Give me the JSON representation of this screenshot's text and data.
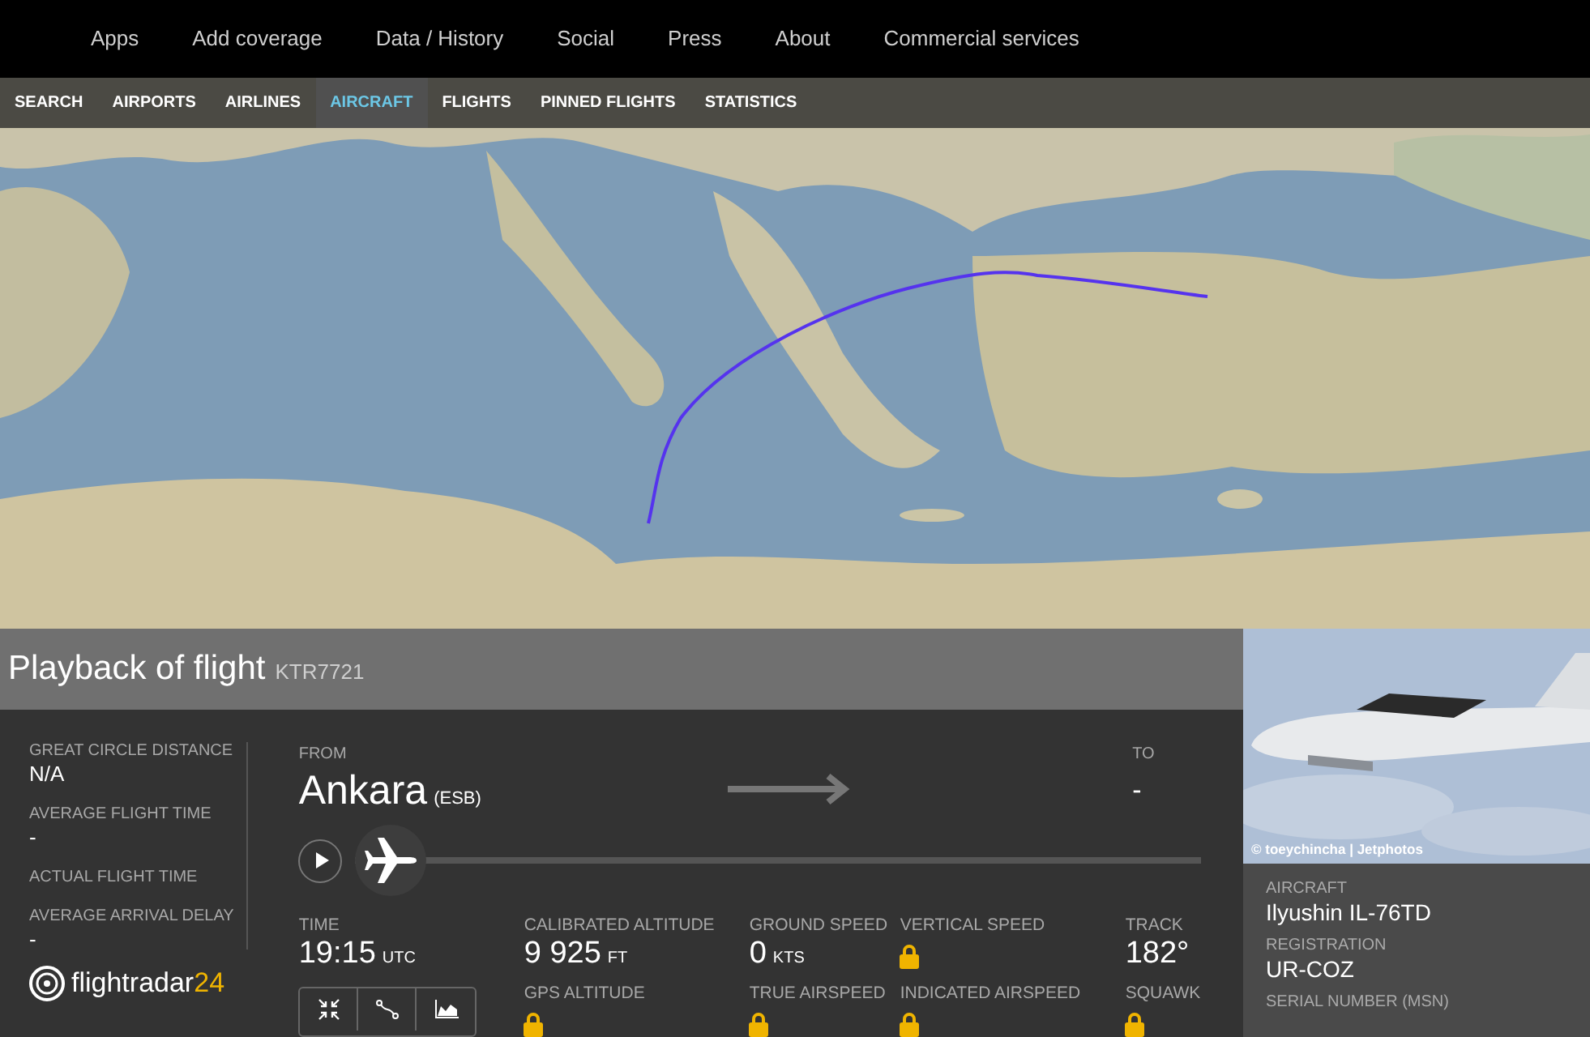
{
  "top_nav": [
    "Apps",
    "Add coverage",
    "Data / History",
    "Social",
    "Press",
    "About",
    "Commercial services"
  ],
  "sub_nav": [
    {
      "label": "SEARCH",
      "selected": false
    },
    {
      "label": "AIRPORTS",
      "selected": false
    },
    {
      "label": "AIRLINES",
      "selected": false
    },
    {
      "label": "AIRCRAFT",
      "selected": true
    },
    {
      "label": "FLIGHTS",
      "selected": false
    },
    {
      "label": "PINNED FLIGHTS",
      "selected": false
    },
    {
      "label": "STATISTICS",
      "selected": false
    }
  ],
  "header": {
    "title": "Playback of flight",
    "flight": "KTR7721"
  },
  "summary": [
    {
      "label": "GREAT CIRCLE DISTANCE",
      "value": "N/A"
    },
    {
      "label": "AVERAGE FLIGHT TIME",
      "value": "-"
    },
    {
      "label": "ACTUAL FLIGHT TIME"
    },
    {
      "label": "AVERAGE ARRIVAL DELAY",
      "value": "-"
    }
  ],
  "logo": {
    "name": "flightradar",
    "suffix": "24"
  },
  "route": {
    "from_label": "FROM",
    "from_city": "Ankara",
    "from_code": "(ESB)",
    "to_label": "TO",
    "to_city": "-"
  },
  "playback": {
    "playing": false,
    "level": 0
  },
  "stats": [
    {
      "label": "TIME",
      "kind": "value",
      "value": "19:15",
      "unit": "UTC"
    },
    {
      "label": "CALIBRATED ALTITUDE",
      "kind": "value",
      "value": "9 925",
      "unit": "FT"
    },
    {
      "label": "GROUND SPEED",
      "kind": "value",
      "value": "0",
      "unit": "KTS"
    },
    {
      "label": "VERTICAL SPEED",
      "kind": "locked"
    },
    {
      "label": "TRACK",
      "kind": "value",
      "value": "182°"
    },
    {
      "label": "GPS ALTITUDE",
      "kind": "locked"
    },
    {
      "label": "TRUE AIRSPEED",
      "kind": "locked"
    },
    {
      "label": "INDICATED AIRSPEED",
      "kind": "locked"
    },
    {
      "label": "SQUAWK",
      "kind": "locked"
    }
  ],
  "photo": {
    "credit": "© toeychincha | Jetphotos"
  },
  "aircraft": [
    {
      "label": "AIRCRAFT",
      "value": "Ilyushin IL-76TD"
    },
    {
      "label": "REGISTRATION",
      "value": "UR-COZ"
    },
    {
      "label": "SERIAL NUMBER (MSN)"
    }
  ]
}
